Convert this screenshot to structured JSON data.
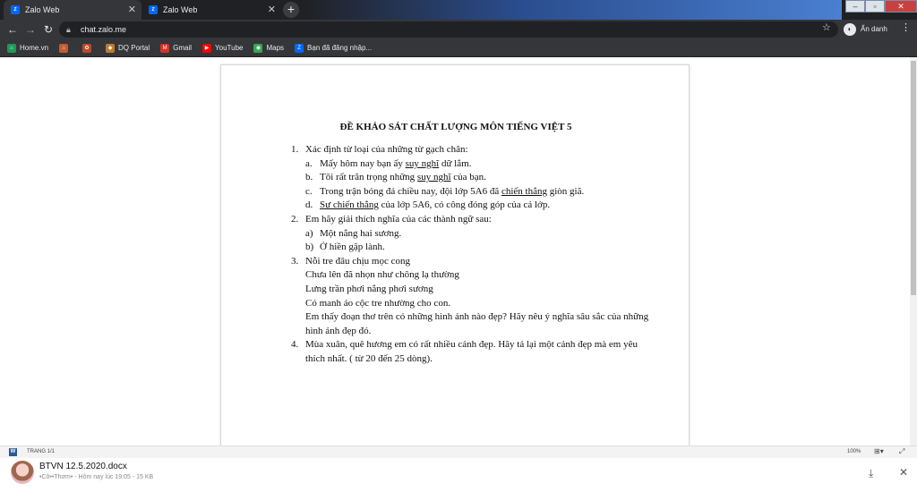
{
  "browser": {
    "tabs": [
      {
        "title": "Zalo Web",
        "favicon": "zalo-icon"
      },
      {
        "title": "Zalo Web",
        "favicon": "zalo-icon"
      }
    ],
    "new_tab": "+",
    "url": "chat.zalo.me",
    "profile_label": "Ẩn danh",
    "bookmarks": [
      {
        "label": "Home.vn",
        "icon": "home-icon"
      },
      {
        "label": "",
        "icon": "house-icon"
      },
      {
        "label": "",
        "icon": "gear-icon"
      },
      {
        "label": "DQ Portal",
        "icon": "portal-icon"
      },
      {
        "label": "Gmail",
        "icon": "gmail-icon"
      },
      {
        "label": "YouTube",
        "icon": "youtube-icon"
      },
      {
        "label": "Maps",
        "icon": "maps-icon"
      },
      {
        "label": "Bạn đã đăng nhập...",
        "icon": "zalo-icon"
      }
    ]
  },
  "document": {
    "title": "ĐỀ KHẢO SÁT CHẤT LƯỢNG MÔN TIẾNG VIỆT 5",
    "q1": {
      "num": "1.",
      "text": "Xác định từ loại của những từ gạch chân:",
      "items": [
        {
          "let": "a.",
          "pre": "Mấy hôm nay bạn ấy ",
          "u": "suy nghĩ",
          "post": " dữ lắm."
        },
        {
          "let": "b.",
          "pre": "Tôi rất trân trọng những ",
          "u": "suy nghĩ",
          "post": " của bạn."
        },
        {
          "let": "c.",
          "pre": "Trong trận bóng đá chiều nay, đội lớp 5A6 đã ",
          "u": "chiến thắng",
          "post": " giòn giã."
        },
        {
          "let": "d.",
          "pre": "",
          "u": "Sự chiến thắng",
          "post": " của lớp 5A6, có công đóng góp của cả lớp."
        }
      ]
    },
    "q2": {
      "num": "2.",
      "text": "Em hãy giải thích nghĩa của các thành ngữ sau:",
      "items": [
        {
          "let": "a)",
          "text": "Một nắng hai sương."
        },
        {
          "let": "b)",
          "text": "Ở hiền gặp lành."
        }
      ]
    },
    "q3": {
      "num": "3.",
      "lines": [
        "Nỗi tre đâu chịu mọc cong",
        "Chưa lên đã nhọn như chông lạ thường",
        "Lưng trần phơi nắng phơi sương",
        "Có manh áo cộc tre nhường cho con.",
        "Em thấy đoạn thơ trên có những hình ảnh nào đẹp? Hãy nêu ý nghĩa sâu sắc của những hình ảnh đẹp đó."
      ]
    },
    "q4": {
      "num": "4.",
      "text": "Mùa xuân, quê hương em có rất nhiều cảnh đẹp. Hãy tả lại một cảnh đẹp mà em yêu thích nhất. ( từ 20 đến 25 dòng)."
    }
  },
  "status": {
    "page": "TRANG 1/1",
    "zoom": "100%"
  },
  "file": {
    "name": "BTVN 12.5.2020.docx",
    "meta": "•Cô••Thơm• - Hôm nay lúc 19:05 - 15 KB"
  }
}
